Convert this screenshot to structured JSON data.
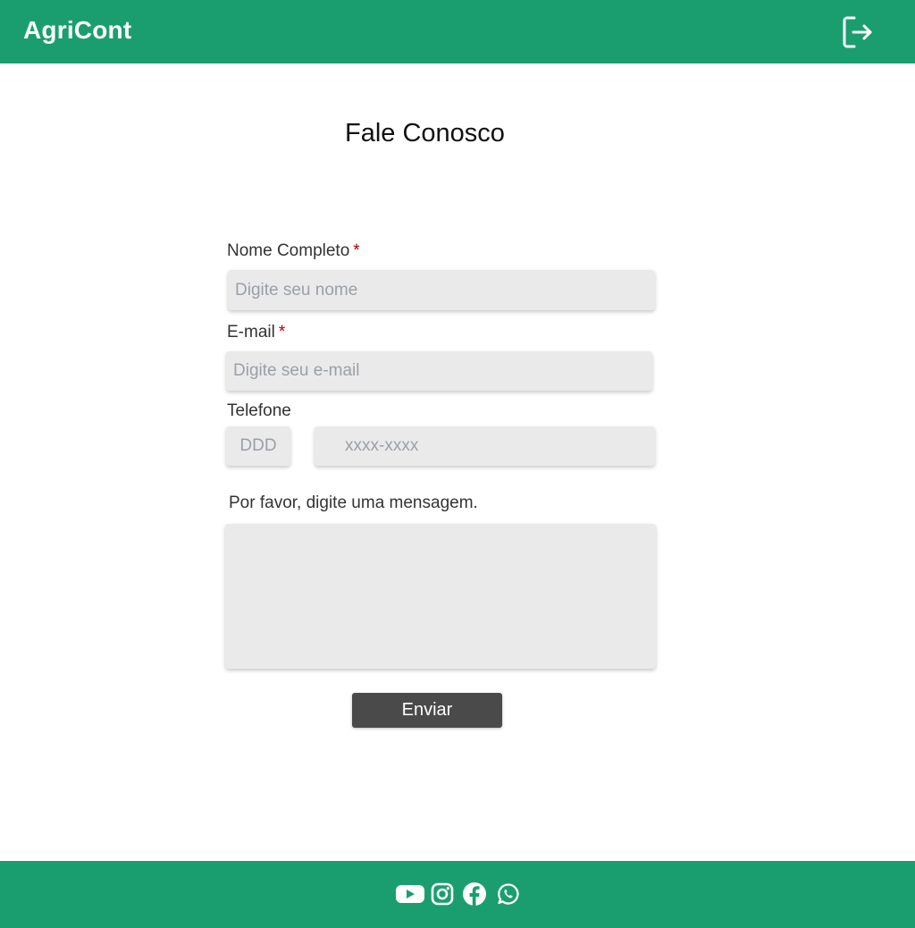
{
  "header": {
    "brand": "AgriCont",
    "logout_icon": "logout-icon",
    "color": "#1a9e70"
  },
  "page": {
    "title": "Fale Conosco"
  },
  "form": {
    "name": {
      "label": "Nome Completo",
      "required_mark": "*",
      "placeholder": "Digite seu nome",
      "value": ""
    },
    "email": {
      "label": "E-mail",
      "required_mark": "*",
      "placeholder": "Digite seu e-mail",
      "value": ""
    },
    "phone": {
      "label": "Telefone",
      "ddd_placeholder": "DDD",
      "number_placeholder": "xxxx-xxxx"
    },
    "message": {
      "label": "Por favor, digite uma mensagem.",
      "value": ""
    },
    "submit_label": "Enviar"
  },
  "footer": {
    "social_icons": [
      "youtube-icon",
      "instagram-icon",
      "facebook-icon",
      "whatsapp-icon"
    ]
  }
}
